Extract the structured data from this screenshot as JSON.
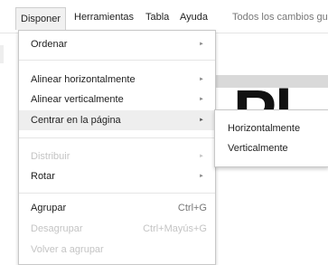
{
  "menubar": {
    "items": [
      {
        "label": "Disponer"
      },
      {
        "label": "Herramientas"
      },
      {
        "label": "Tabla"
      },
      {
        "label": "Ayuda"
      }
    ],
    "status": "Todos los cambios gu"
  },
  "background": {
    "big_text": "Pl"
  },
  "menu": {
    "items": [
      {
        "label": "Ordenar",
        "arrow": "►"
      },
      {
        "label": "Alinear horizontalmente",
        "arrow": "►"
      },
      {
        "label": "Alinear verticalmente",
        "arrow": "►"
      },
      {
        "label": "Centrar en la página",
        "arrow": "►"
      },
      {
        "label": "Distribuir",
        "arrow": "►"
      },
      {
        "label": "Rotar",
        "arrow": "►"
      },
      {
        "label": "Agrupar",
        "shortcut": "Ctrl+G"
      },
      {
        "label": "Desagrupar",
        "shortcut": "Ctrl+Mayús+G"
      },
      {
        "label": "Volver a agrupar"
      }
    ]
  },
  "submenu": {
    "items": [
      {
        "label": "Horizontalmente"
      },
      {
        "label": "Verticalmente"
      }
    ]
  }
}
